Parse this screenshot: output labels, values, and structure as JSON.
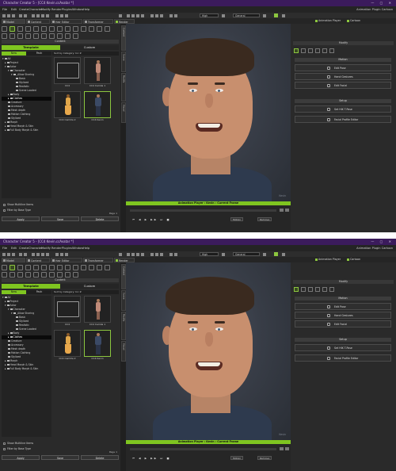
{
  "app": {
    "window_title": "Character Creator 5 - [CC4 Kevin.ccAvatar *]"
  },
  "menu": [
    "File",
    "Edit",
    "Create",
    "Character",
    "Modify",
    "Render",
    "Plugins",
    "Window",
    "Help",
    "Plugins",
    "Script",
    "Help"
  ],
  "menu_right": "Animation Plugin  Cartoon",
  "toolbar": {
    "view_dropdown": "High",
    "render_dropdown": "General"
  },
  "tabs": [
    "Model",
    "Content",
    "Hair Editor",
    "Transformer",
    "Render"
  ],
  "tabs_right": [
    "Animation Player",
    "Cartoon"
  ],
  "left_panel": {
    "content_header": "Content",
    "template_tab": "Template",
    "custom_tab": "Custom",
    "nav": {
      "new": "New",
      "pack": "Pack"
    },
    "filters": [
      "Actor",
      "Character",
      "Default"
    ],
    "sort_label": "Sort by Category: Inc Z",
    "tree": [
      {
        "label": "All",
        "indent": 0
      },
      {
        "label": "Project",
        "indent": 1
      },
      {
        "label": "Actor",
        "indent": 1
      },
      {
        "label": "Character",
        "indent": 2
      },
      {
        "label": "_Allow Sharing",
        "indent": 3
      },
      {
        "label": "Basic",
        "indent": 4
      },
      {
        "label": "Stylized",
        "indent": 4
      },
      {
        "label": "Realistic",
        "indent": 4
      },
      {
        "label": "Scene Loaded",
        "indent": 4
      },
      {
        "label": "Body",
        "indent": 2
      },
      {
        "label": "Clothes",
        "indent": 2
      },
      {
        "label": "Creature",
        "indent": 2
      },
      {
        "label": "Accessory",
        "indent": 2
      },
      {
        "label": "Mesh depth",
        "indent": 2
      },
      {
        "label": "Motion Clothing",
        "indent": 2
      },
      {
        "label": "Stylized",
        "indent": 2
      },
      {
        "label": "Morph",
        "indent": 1
      },
      {
        "label": "Head Morph & Skin",
        "indent": 1
      },
      {
        "label": "Full Body Morph & Skin",
        "indent": 1
      }
    ],
    "selected_tree_index": 10,
    "items": [
      {
        "caption": "CC4",
        "type": "folder"
      },
      {
        "caption": "CC4 Camila 1",
        "type": "figure"
      },
      {
        "caption": "CC4 Camilla 2",
        "type": "figure"
      },
      {
        "caption": "CC4 Kevin",
        "type": "figure"
      }
    ],
    "page_label": "Page 1",
    "checkboxes": [
      "Show Multiline Items",
      "Filter by Base Type"
    ],
    "bottom_buttons": [
      "Apply",
      "Save",
      "Delete"
    ]
  },
  "side_tabs": [
    "Content",
    "Scene",
    "Modify",
    "Visual"
  ],
  "viewport": {
    "watermark": "Kevin"
  },
  "animation_player": {
    "title": "Animation Player : Kevin : Current Frame",
    "motion_button": "Motion",
    "remove_button": "Remove"
  },
  "right_panel": {
    "header": "Modify",
    "section_motion": "Motion",
    "motion_buttons": [
      "Edit Pose",
      "Hand Gestures",
      "Edit Facial"
    ],
    "section_setup": "Setup",
    "setup_buttons": [
      "Set HIK T-Pose",
      "Facial Profile Editor"
    ]
  }
}
